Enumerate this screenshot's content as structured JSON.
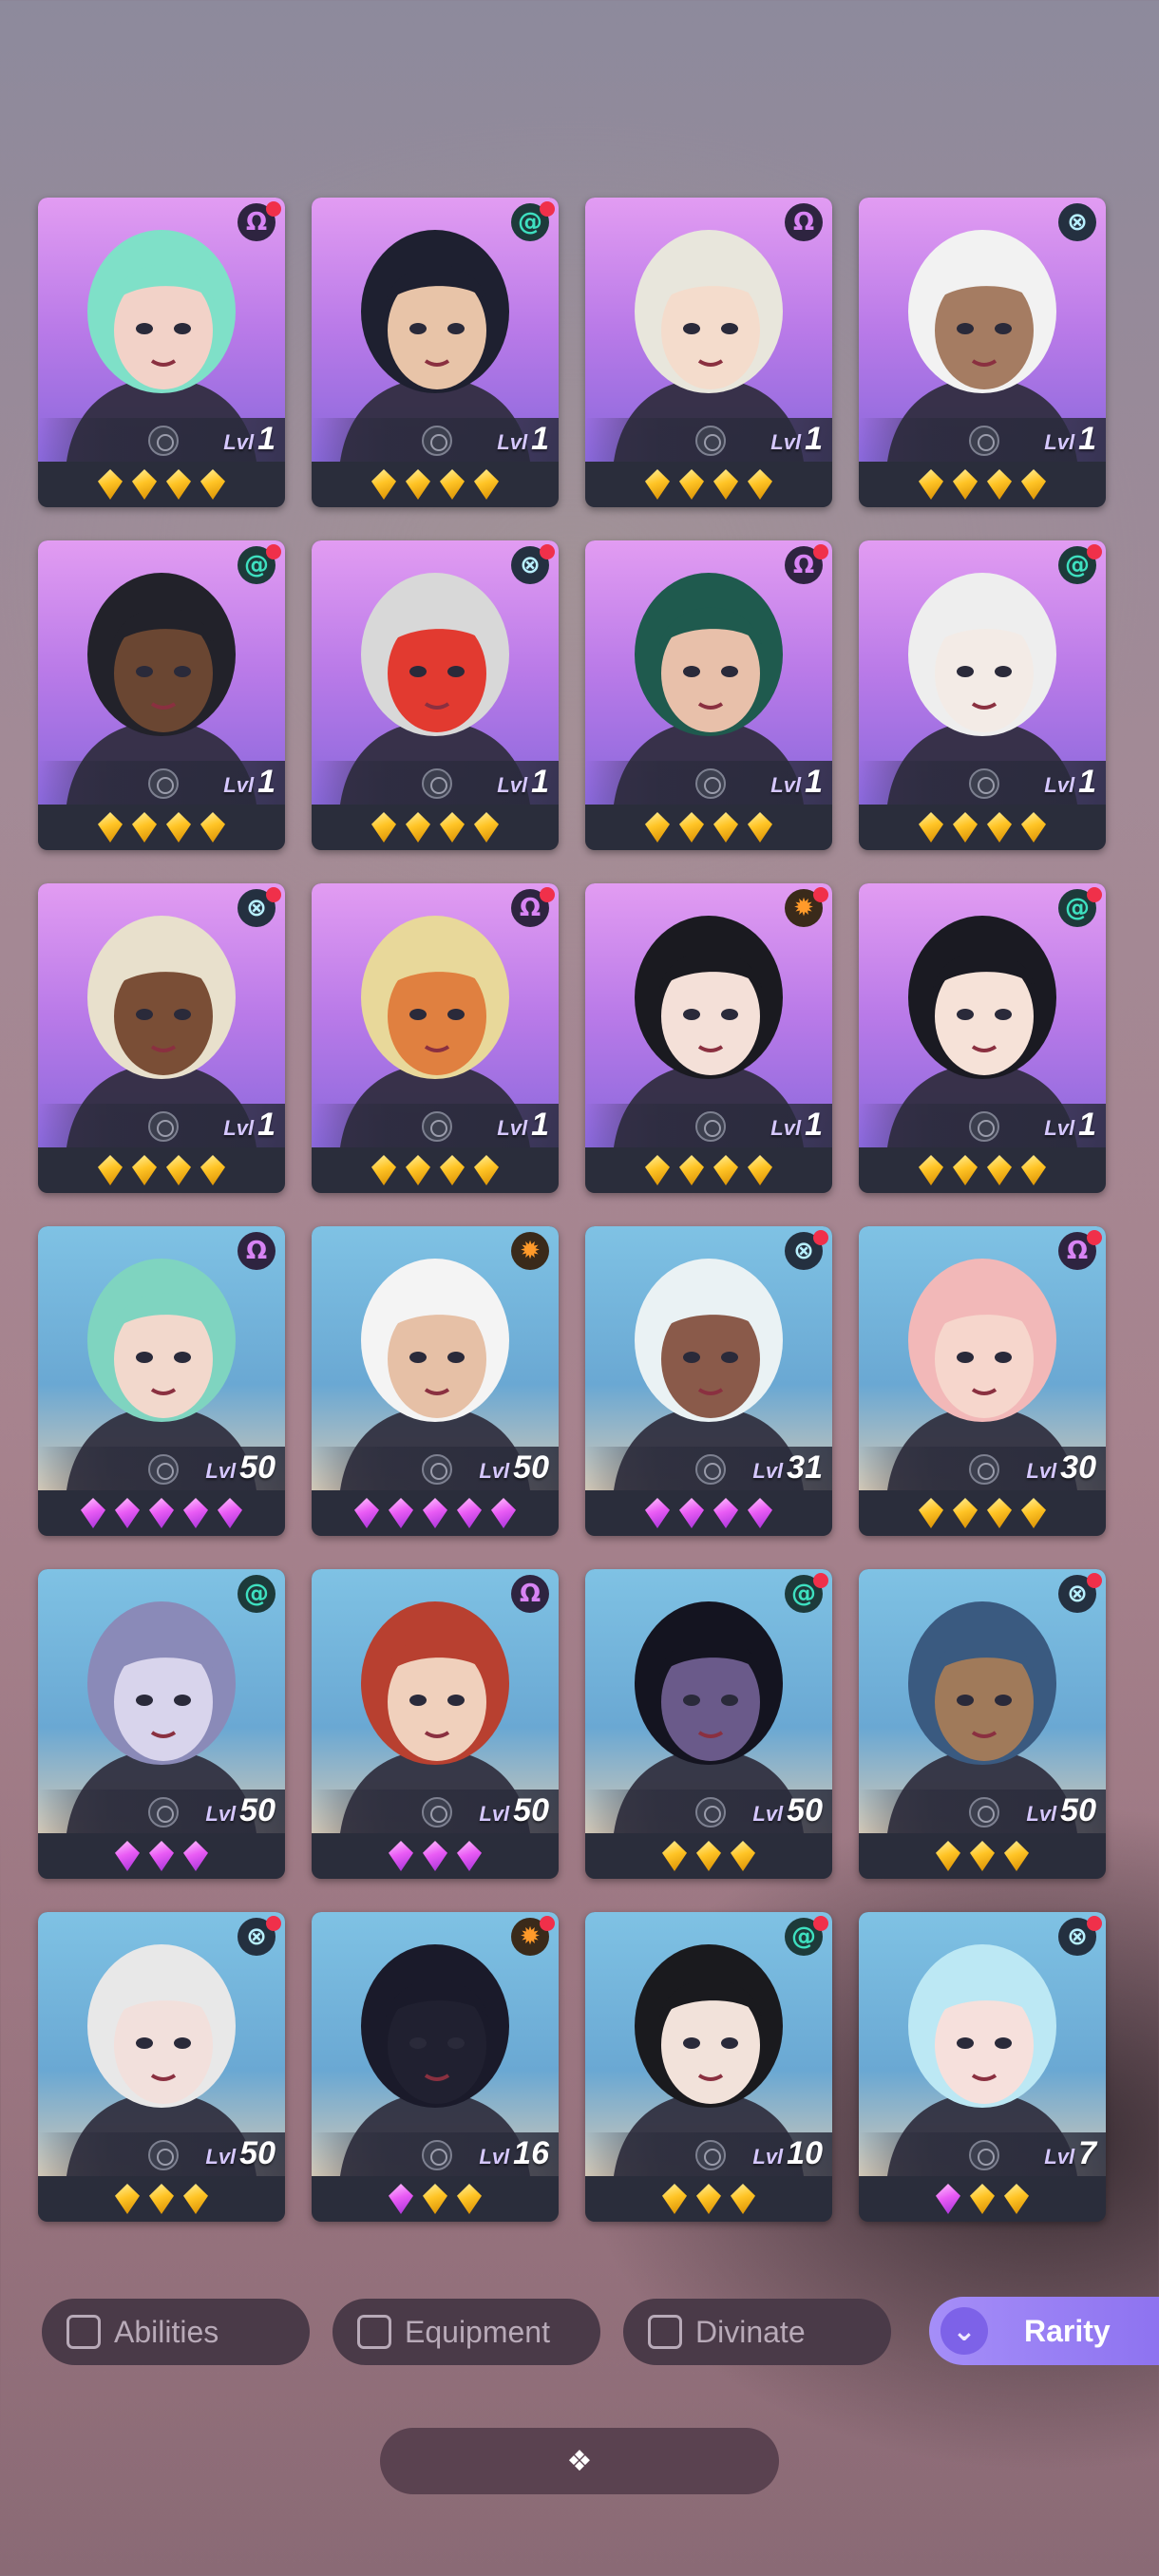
{
  "level_prefix": "Lvl",
  "characters": [
    {
      "element": "omega",
      "level": "1",
      "gems": [
        "gold",
        "gold",
        "gold",
        "gold"
      ],
      "bg": "purple",
      "notify": true,
      "hair": "#7fe0c8",
      "skin": "#f2d2c8"
    },
    {
      "element": "swirl",
      "level": "1",
      "gems": [
        "gold",
        "gold",
        "gold",
        "gold"
      ],
      "bg": "purple",
      "notify": true,
      "hair": "#1e2030",
      "skin": "#e8c4a8"
    },
    {
      "element": "omega",
      "level": "1",
      "gems": [
        "gold",
        "gold",
        "gold",
        "gold"
      ],
      "bg": "purple",
      "notify": false,
      "hair": "#e8e6dc",
      "skin": "#f4dccc"
    },
    {
      "element": "cross",
      "level": "1",
      "gems": [
        "gold",
        "gold",
        "gold",
        "gold"
      ],
      "bg": "purple",
      "notify": false,
      "hair": "#f2f2f2",
      "skin": "#a57c62"
    },
    {
      "element": "swirl",
      "level": "1",
      "gems": [
        "gold",
        "gold",
        "gold",
        "gold"
      ],
      "bg": "purple",
      "notify": true,
      "hair": "#22222a",
      "skin": "#6a4632"
    },
    {
      "element": "cross",
      "level": "1",
      "gems": [
        "gold",
        "gold",
        "gold",
        "gold"
      ],
      "bg": "purple",
      "notify": true,
      "hair": "#d8d8d8",
      "skin": "#e23a30"
    },
    {
      "element": "omega",
      "level": "1",
      "gems": [
        "gold",
        "gold",
        "gold",
        "gold"
      ],
      "bg": "purple",
      "notify": true,
      "hair": "#1f5a4e",
      "skin": "#e8c0aa"
    },
    {
      "element": "swirl",
      "level": "1",
      "gems": [
        "gold",
        "gold",
        "gold",
        "gold"
      ],
      "bg": "purple",
      "notify": true,
      "hair": "#eeeeee",
      "skin": "#f3ebe6"
    },
    {
      "element": "cross",
      "level": "1",
      "gems": [
        "gold",
        "gold",
        "gold",
        "gold"
      ],
      "bg": "purple",
      "notify": true,
      "hair": "#e8e0cc",
      "skin": "#7a4e36"
    },
    {
      "element": "omega",
      "level": "1",
      "gems": [
        "gold",
        "gold",
        "gold",
        "gold"
      ],
      "bg": "purple",
      "notify": true,
      "hair": "#e8d89a",
      "skin": "#e08040"
    },
    {
      "element": "sun",
      "level": "1",
      "gems": [
        "gold",
        "gold",
        "gold",
        "gold"
      ],
      "bg": "purple",
      "notify": true,
      "hair": "#1a1a20",
      "skin": "#f4e0d8"
    },
    {
      "element": "swirl",
      "level": "1",
      "gems": [
        "gold",
        "gold",
        "gold",
        "gold"
      ],
      "bg": "purple",
      "notify": true,
      "hair": "#1a1a22",
      "skin": "#f6e2d8"
    },
    {
      "element": "omega",
      "level": "50",
      "gems": [
        "pink",
        "pink",
        "pink",
        "pink",
        "pink"
      ],
      "bg": "blue",
      "notify": false,
      "hair": "#7fd4c0",
      "skin": "#f2d8cc"
    },
    {
      "element": "sun",
      "level": "50",
      "gems": [
        "pink",
        "pink",
        "pink",
        "pink",
        "pink"
      ],
      "bg": "blue",
      "notify": false,
      "hair": "#f4f4f4",
      "skin": "#e6c0a6"
    },
    {
      "element": "cross",
      "level": "31",
      "gems": [
        "pink",
        "pink",
        "pink",
        "pink"
      ],
      "bg": "blue",
      "notify": true,
      "hair": "#eaf2f4",
      "skin": "#8a5a4a"
    },
    {
      "element": "omega",
      "level": "30",
      "gems": [
        "gold",
        "gold",
        "gold",
        "gold"
      ],
      "bg": "blue",
      "notify": true,
      "hair": "#f2b8b8",
      "skin": "#f6d6cc"
    },
    {
      "element": "swirl",
      "level": "50",
      "gems": [
        "pink",
        "pink",
        "pink"
      ],
      "bg": "blue",
      "notify": false,
      "hair": "#8a8ab8",
      "skin": "#d8d4ec"
    },
    {
      "element": "omega",
      "level": "50",
      "gems": [
        "pink",
        "pink",
        "pink"
      ],
      "bg": "blue",
      "notify": false,
      "hair": "#b84030",
      "skin": "#f0d0bc"
    },
    {
      "element": "swirl",
      "level": "50",
      "gems": [
        "gold",
        "gold",
        "gold"
      ],
      "bg": "blue",
      "notify": true,
      "hair": "#141420",
      "skin": "#6a5a8a"
    },
    {
      "element": "cross",
      "level": "50",
      "gems": [
        "gold",
        "gold",
        "gold"
      ],
      "bg": "blue",
      "notify": true,
      "hair": "#3a5a80",
      "skin": "#a07a5a"
    },
    {
      "element": "cross",
      "level": "50",
      "gems": [
        "gold",
        "gold",
        "gold"
      ],
      "bg": "blue",
      "notify": true,
      "hair": "#e8e8e8",
      "skin": "#f2e0dc"
    },
    {
      "element": "sun",
      "level": "16",
      "gems": [
        "pink",
        "gold",
        "gold"
      ],
      "bg": "blue",
      "notify": true,
      "hair": "#1a1a2a",
      "skin": "#202030"
    },
    {
      "element": "swirl",
      "level": "10",
      "gems": [
        "gold",
        "gold",
        "gold"
      ],
      "bg": "blue",
      "notify": true,
      "hair": "#1a1a1e",
      "skin": "#f2e2da"
    },
    {
      "element": "cross",
      "level": "7",
      "gems": [
        "pink",
        "gold",
        "gold"
      ],
      "bg": "blue",
      "notify": true,
      "hair": "#bce8f4",
      "skin": "#f6e0dc"
    }
  ],
  "element_icons": {
    "omega": "Ω",
    "swirl": "@",
    "cross": "⊗",
    "sun": "✹"
  },
  "filters": {
    "abilities": "Abilities",
    "equipment": "Equipment",
    "divinate": "Divinate",
    "rarity": "Rarity"
  },
  "bottom_icon": "expand-arrows-icon"
}
